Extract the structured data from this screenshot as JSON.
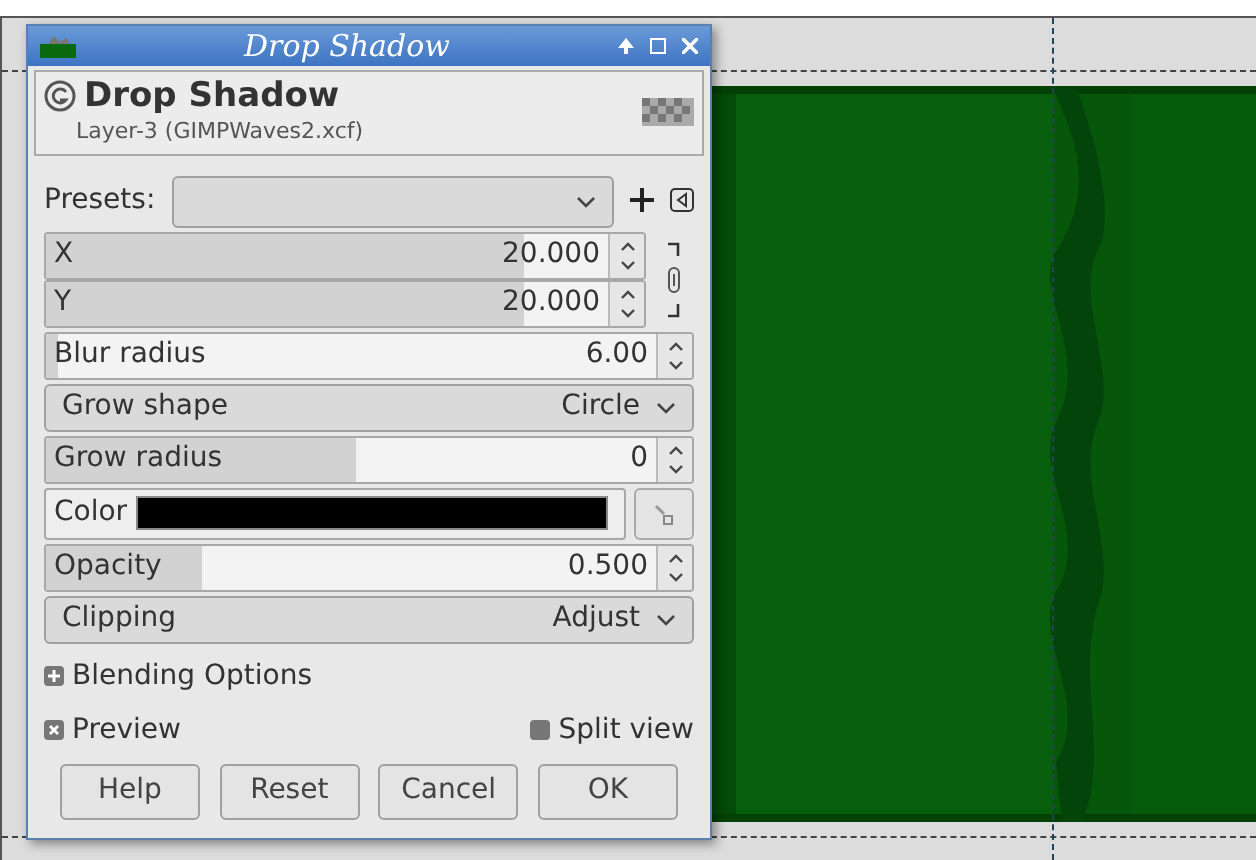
{
  "window": {
    "title": "Drop Shadow"
  },
  "header": {
    "title": "Drop Shadow",
    "subtitle": "Layer-3 (GIMPWaves2.xcf)"
  },
  "presets": {
    "label": "Presets:"
  },
  "offset": {
    "chained": true,
    "fields": [
      {
        "label": "X",
        "value": "20.000",
        "level": 0.8
      },
      {
        "label": "Y",
        "value": "20.000",
        "level": 0.8
      }
    ]
  },
  "fields": [
    {
      "kind": "spin",
      "label": "Blur radius",
      "value": "6.00",
      "level": 0.02
    },
    {
      "kind": "combo",
      "label": "Grow shape",
      "value": "Circle"
    },
    {
      "kind": "spin",
      "label": "Grow radius",
      "value": "0",
      "level": 0.48
    },
    {
      "kind": "color",
      "label": "Color",
      "color": "#000000"
    },
    {
      "kind": "spin",
      "label": "Opacity",
      "value": "0.500",
      "level": 0.24
    },
    {
      "kind": "combo",
      "label": "Clipping",
      "value": "Adjust"
    }
  ],
  "blending": {
    "label": "Blending Options",
    "expanded": false
  },
  "preview": {
    "label": "Preview",
    "checked": true
  },
  "split_view": {
    "label": "Split view",
    "checked": false
  },
  "buttons": [
    "Help",
    "Reset",
    "Cancel",
    "OK"
  ]
}
